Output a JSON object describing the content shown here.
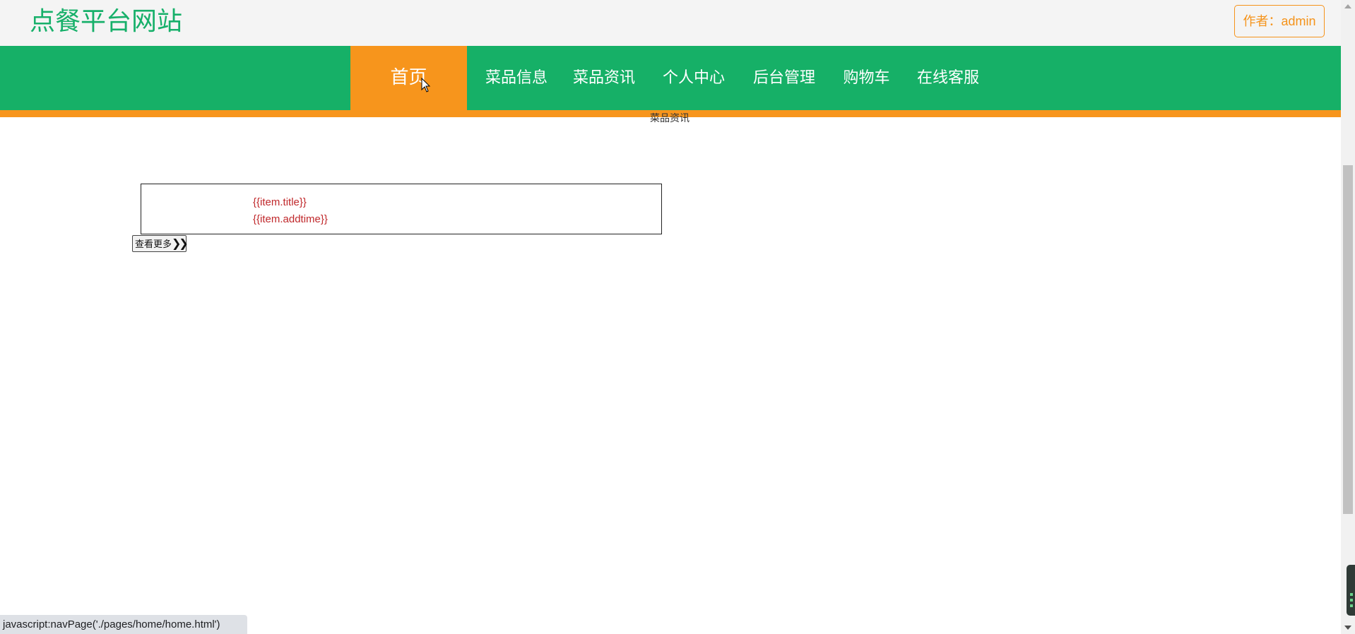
{
  "header": {
    "site_title": "点餐平台网站",
    "author_label": "作者：admin"
  },
  "nav": {
    "items": [
      {
        "label": "首页",
        "active": true
      },
      {
        "label": "菜品信息",
        "active": false
      },
      {
        "label": "菜品资讯",
        "active": false
      },
      {
        "label": "个人中心",
        "active": false
      },
      {
        "label": "后台管理",
        "active": false
      },
      {
        "label": "购物车",
        "active": false
      },
      {
        "label": "在线客服",
        "active": false
      }
    ]
  },
  "section": {
    "caption": "菜品资讯"
  },
  "news": {
    "title": "{{item.title}}",
    "addtime": "{{item.addtime}}",
    "more_label": "查看更多"
  },
  "status_bar": {
    "text": "javascript:navPage('./pages/home/home.html')"
  },
  "colors": {
    "brand_green": "#16b067",
    "accent_orange": "#f7951c",
    "news_red": "#c0282b"
  }
}
